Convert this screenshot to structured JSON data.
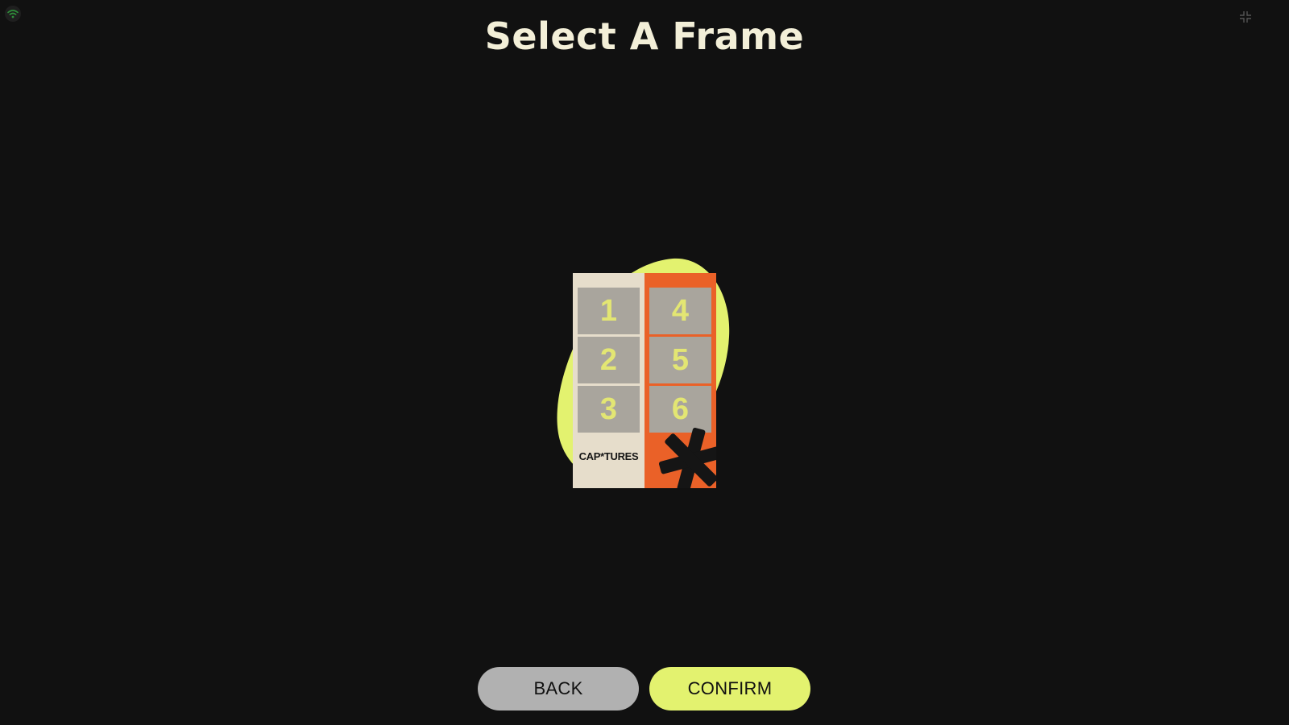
{
  "app": {
    "title": "Select A Frame"
  },
  "status_bar": {
    "wifi_icon": "wifi-icon",
    "wifi_color": "#2f8f3a",
    "minimize_icon": "minimize-icon"
  },
  "frame": {
    "brand": "CAP*TURES",
    "slots": [
      "1",
      "2",
      "3",
      "4",
      "5",
      "6"
    ],
    "decoration_icon": "asterisk-icon",
    "colors": {
      "blob": "#e3f26f",
      "left_strip": "#e6ddcb",
      "right_strip": "#ea6128",
      "slot": "#a9a59d",
      "slot_number": "#e3e673"
    }
  },
  "buttons": {
    "back_label": "BACK",
    "confirm_label": "CONFIRM"
  },
  "colors": {
    "background": "#111111",
    "title": "#f3efd8",
    "back_button": "#b1b1b1",
    "confirm_button": "#e3f26f"
  }
}
